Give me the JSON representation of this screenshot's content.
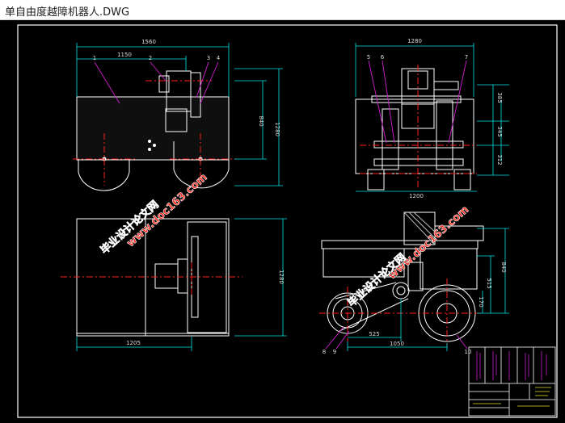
{
  "window": {
    "title": "单自由度越障机器人.DWG"
  },
  "drawing": {
    "top_view": {
      "overall_width": "1560",
      "width_1150": "1150",
      "height_840": "840",
      "height_1280": "1280",
      "balloons": [
        "1",
        "2",
        "3",
        "4"
      ]
    },
    "side_view": {
      "top_width": "1280",
      "bottom_width": "1200",
      "dim_385": "385",
      "dim_345": "345",
      "dim_312": "312",
      "balloons": [
        "5",
        "6",
        "7"
      ]
    },
    "front_view": {
      "width_1205": "1205",
      "height_1280": "1280"
    },
    "iso_view": {
      "dim_840": "840",
      "dim_515": "515",
      "dim_170": "170",
      "dim_525": "525",
      "dim_1050": "1050",
      "balloons": [
        "8",
        "9",
        "10"
      ]
    },
    "watermark": {
      "line1": "毕业设计论文网",
      "line2": "www.doc163.com"
    }
  },
  "colors": {
    "background": "#000000",
    "outline": "#ffffff",
    "centerline": "#ff2020",
    "dimension": "#00e5e5",
    "leader": "#d020d0",
    "frame": "#ffffff",
    "watermark_text": "#ff2a1f",
    "watermark_stroke": "#ffffff"
  }
}
